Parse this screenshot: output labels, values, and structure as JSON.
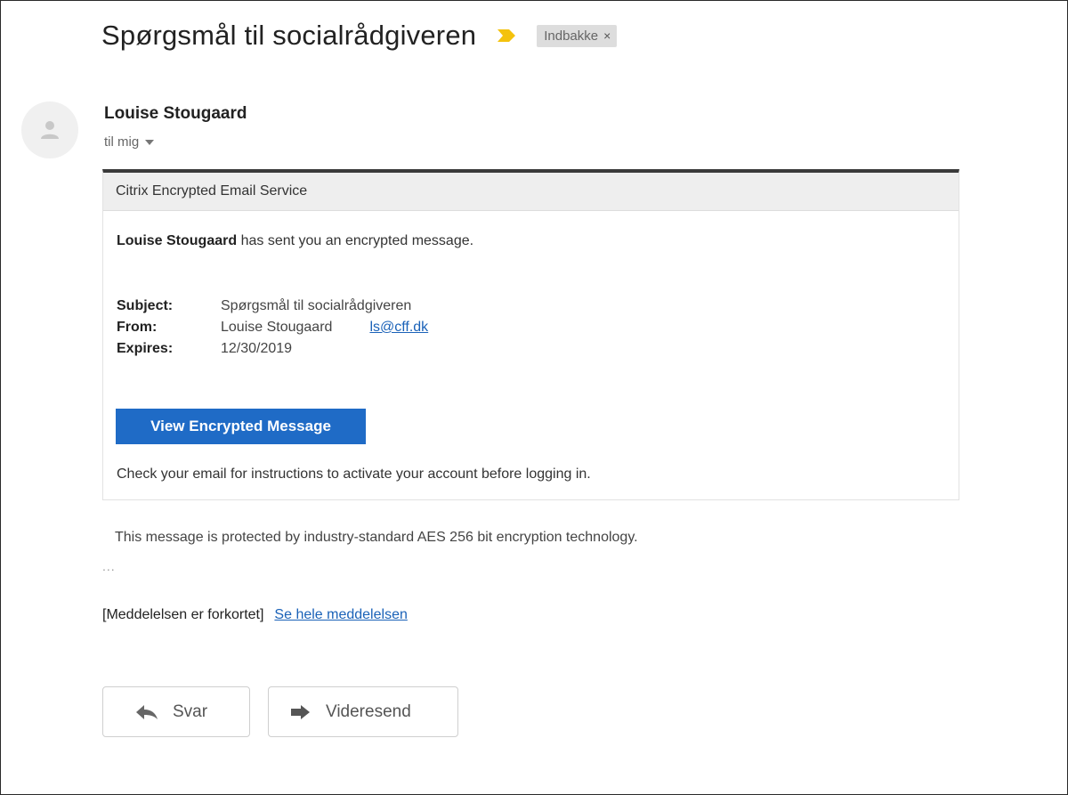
{
  "email": {
    "subject": "Spørgsmål til socialrådgiveren",
    "label": "Indbakke",
    "label_close": "×",
    "sender_name": "Louise Stougaard",
    "recipient": "til mig"
  },
  "card": {
    "header": "Citrix Encrypted Email Service",
    "notice_sender": "Louise Stougaard",
    "notice_text": " has sent you an encrypted message.",
    "meta": {
      "subject_label": "Subject:",
      "subject_value": "Spørgsmål til socialrådgiveren",
      "from_label": "From:",
      "from_value": "Louise Stougaard",
      "from_email": "ls@cff.dk",
      "expires_label": "Expires:",
      "expires_value": "12/30/2019"
    },
    "button_label": "View Encrypted Message",
    "instructions": "Check your email for instructions to activate your account before logging in."
  },
  "footer": {
    "note": "This message is protected by industry-standard AES 256 bit encryption technology.",
    "ellipsis": "...",
    "trimmed_text": "[Meddelelsen er forkortet]",
    "trimmed_link": "Se hele meddelelsen"
  },
  "actions": {
    "reply_label": "Svar",
    "forward_label": "Videresend"
  },
  "icons": {
    "importance": "importance-marker-icon",
    "avatar": "person-icon",
    "caret": "caret-down-icon",
    "reply": "reply-arrow-icon",
    "forward": "forward-arrow-icon"
  },
  "colors": {
    "importance_marker": "#f4c20d",
    "button_blue": "#1f6bc6",
    "link_blue": "#1a62b8",
    "card_border_top": "#3a3a3a",
    "card_header_bg": "#eeeeee"
  }
}
